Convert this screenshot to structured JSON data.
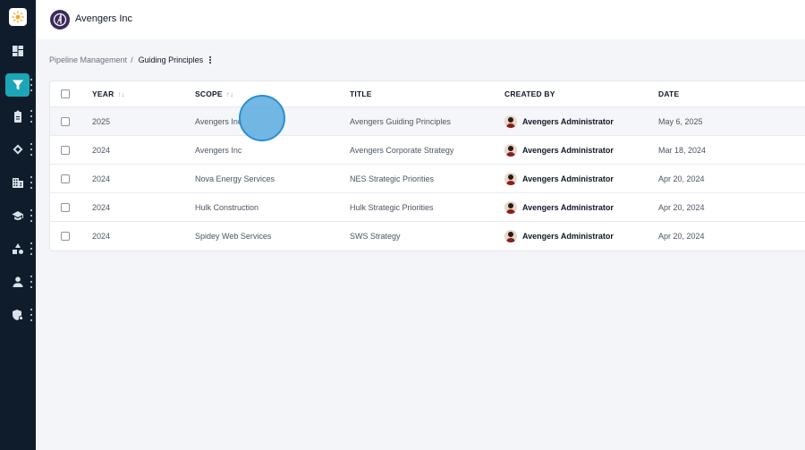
{
  "app": {
    "org_name": "Avengers Inc",
    "accent_color": "#1aa6b7",
    "rail_color": "#0f1c2b"
  },
  "rail": {
    "items": [
      {
        "icon": "dashboard-icon"
      },
      {
        "icon": "funnel-icon",
        "active": true
      },
      {
        "icon": "clipboard-icon"
      },
      {
        "icon": "handshake-icon"
      },
      {
        "icon": "building-icon"
      },
      {
        "icon": "graduation-cap-icon"
      },
      {
        "icon": "shapes-icon"
      },
      {
        "icon": "user-icon"
      },
      {
        "icon": "shield-gear-icon"
      }
    ]
  },
  "breadcrumb": {
    "parent": "Pipeline Management",
    "separator": "/",
    "current": "Guiding Principles"
  },
  "table": {
    "columns": {
      "year": "YEAR",
      "scope": "SCOPE",
      "title": "TITLE",
      "created_by": "CREATED BY",
      "date": "DATE",
      "sort_glyph": "↑↓"
    },
    "rows": [
      {
        "year": "2025",
        "scope": "Avengers Inc",
        "title": "Avengers Guiding Principles",
        "created_by": "Avengers Administrator",
        "date": "May 6, 2025"
      },
      {
        "year": "2024",
        "scope": "Avengers Inc",
        "title": "Avengers Corporate Strategy",
        "created_by": "Avengers Administrator",
        "date": "Mar 18, 2024"
      },
      {
        "year": "2024",
        "scope": "Nova Energy Services",
        "title": "NES Strategic Priorities",
        "created_by": "Avengers Administrator",
        "date": "Apr 20, 2024"
      },
      {
        "year": "2024",
        "scope": "Hulk Construction",
        "title": "Hulk Strategic Priorities",
        "created_by": "Avengers Administrator",
        "date": "Apr 20, 2024"
      },
      {
        "year": "2024",
        "scope": "Spidey Web Services",
        "title": "SWS Strategy",
        "created_by": "Avengers Administrator",
        "date": "Apr 20, 2024"
      }
    ]
  }
}
